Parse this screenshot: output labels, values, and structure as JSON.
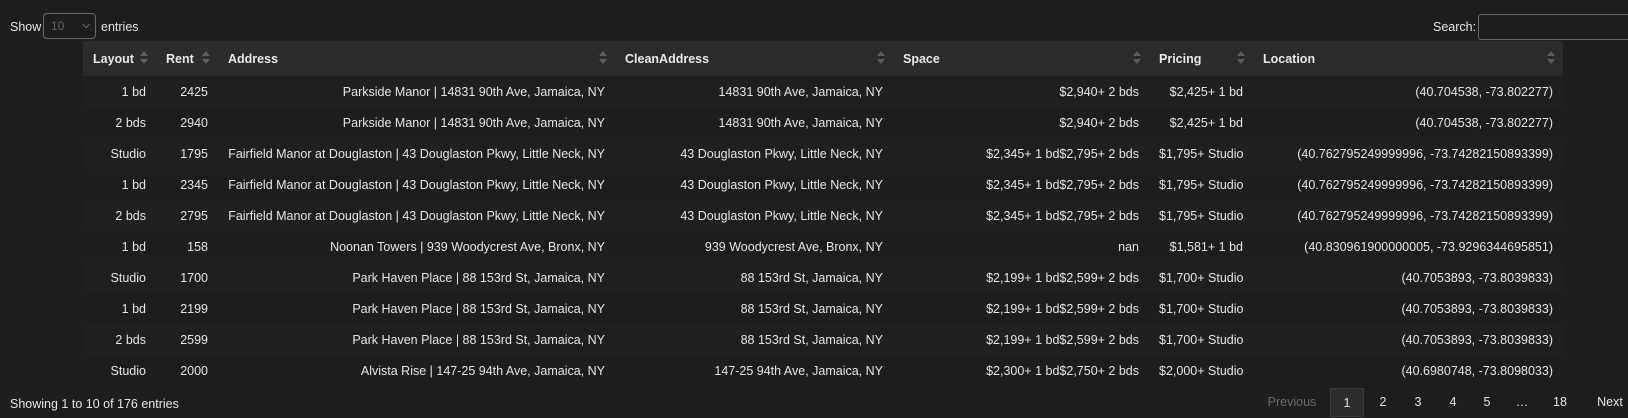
{
  "length_menu": {
    "prefix": "Show",
    "selected": "10",
    "suffix": "entries"
  },
  "search": {
    "label": "Search:",
    "value": ""
  },
  "columns": [
    "Layout",
    "Rent",
    "Address",
    "CleanAddress",
    "Space",
    "Pricing",
    "Location"
  ],
  "rows": [
    [
      "1 bd",
      "2425",
      "Parkside Manor | 14831 90th Ave, Jamaica, NY",
      "14831 90th Ave, Jamaica, NY",
      "$2,940+ 2 bds",
      "$2,425+ 1 bd",
      "(40.704538, -73.802277)"
    ],
    [
      "2 bds",
      "2940",
      "Parkside Manor | 14831 90th Ave, Jamaica, NY",
      "14831 90th Ave, Jamaica, NY",
      "$2,940+ 2 bds",
      "$2,425+ 1 bd",
      "(40.704538, -73.802277)"
    ],
    [
      "Studio",
      "1795",
      "Fairfield Manor at Douglaston | 43 Douglaston Pkwy, Little Neck, NY",
      "43 Douglaston Pkwy, Little Neck, NY",
      "$2,345+ 1 bd$2,795+ 2 bds",
      "$1,795+ Studio",
      "(40.762795249999996, -73.74282150893399)"
    ],
    [
      "1 bd",
      "2345",
      "Fairfield Manor at Douglaston | 43 Douglaston Pkwy, Little Neck, NY",
      "43 Douglaston Pkwy, Little Neck, NY",
      "$2,345+ 1 bd$2,795+ 2 bds",
      "$1,795+ Studio",
      "(40.762795249999996, -73.74282150893399)"
    ],
    [
      "2 bds",
      "2795",
      "Fairfield Manor at Douglaston | 43 Douglaston Pkwy, Little Neck, NY",
      "43 Douglaston Pkwy, Little Neck, NY",
      "$2,345+ 1 bd$2,795+ 2 bds",
      "$1,795+ Studio",
      "(40.762795249999996, -73.74282150893399)"
    ],
    [
      "1 bd",
      "158",
      "Noonan Towers | 939 Woodycrest Ave, Bronx, NY",
      "939 Woodycrest Ave, Bronx, NY",
      "nan",
      "$1,581+ 1 bd",
      "(40.830961900000005, -73.9296344695851)"
    ],
    [
      "Studio",
      "1700",
      "Park Haven Place | 88 153rd St, Jamaica, NY",
      "88 153rd St, Jamaica, NY",
      "$2,199+ 1 bd$2,599+ 2 bds",
      "$1,700+ Studio",
      "(40.7053893, -73.8039833)"
    ],
    [
      "1 bd",
      "2199",
      "Park Haven Place | 88 153rd St, Jamaica, NY",
      "88 153rd St, Jamaica, NY",
      "$2,199+ 1 bd$2,599+ 2 bds",
      "$1,700+ Studio",
      "(40.7053893, -73.8039833)"
    ],
    [
      "2 bds",
      "2599",
      "Park Haven Place | 88 153rd St, Jamaica, NY",
      "88 153rd St, Jamaica, NY",
      "$2,199+ 1 bd$2,599+ 2 bds",
      "$1,700+ Studio",
      "(40.7053893, -73.8039833)"
    ],
    [
      "Studio",
      "2000",
      "Alvista Rise | 147-25 94th Ave, Jamaica, NY",
      "147-25 94th Ave, Jamaica, NY",
      "$2,300+ 1 bd$2,750+ 2 bds",
      "$2,000+ Studio",
      "(40.6980748, -73.8098033)"
    ]
  ],
  "info": "Showing 1 to 10 of 176 entries",
  "pagination": {
    "previous": "Previous",
    "pages": [
      "1",
      "2",
      "3",
      "4",
      "5",
      "…",
      "18"
    ],
    "next": "Next",
    "current": "1"
  },
  "icons": {
    "sort": "sort-both-icon",
    "select_arrow": "chevron-down-icon"
  },
  "colors": {
    "background": "#1d1d1d",
    "header_bg": "#2b2b2b",
    "text": "#e6e6e6",
    "disabled_text": "#6a6a6a"
  }
}
